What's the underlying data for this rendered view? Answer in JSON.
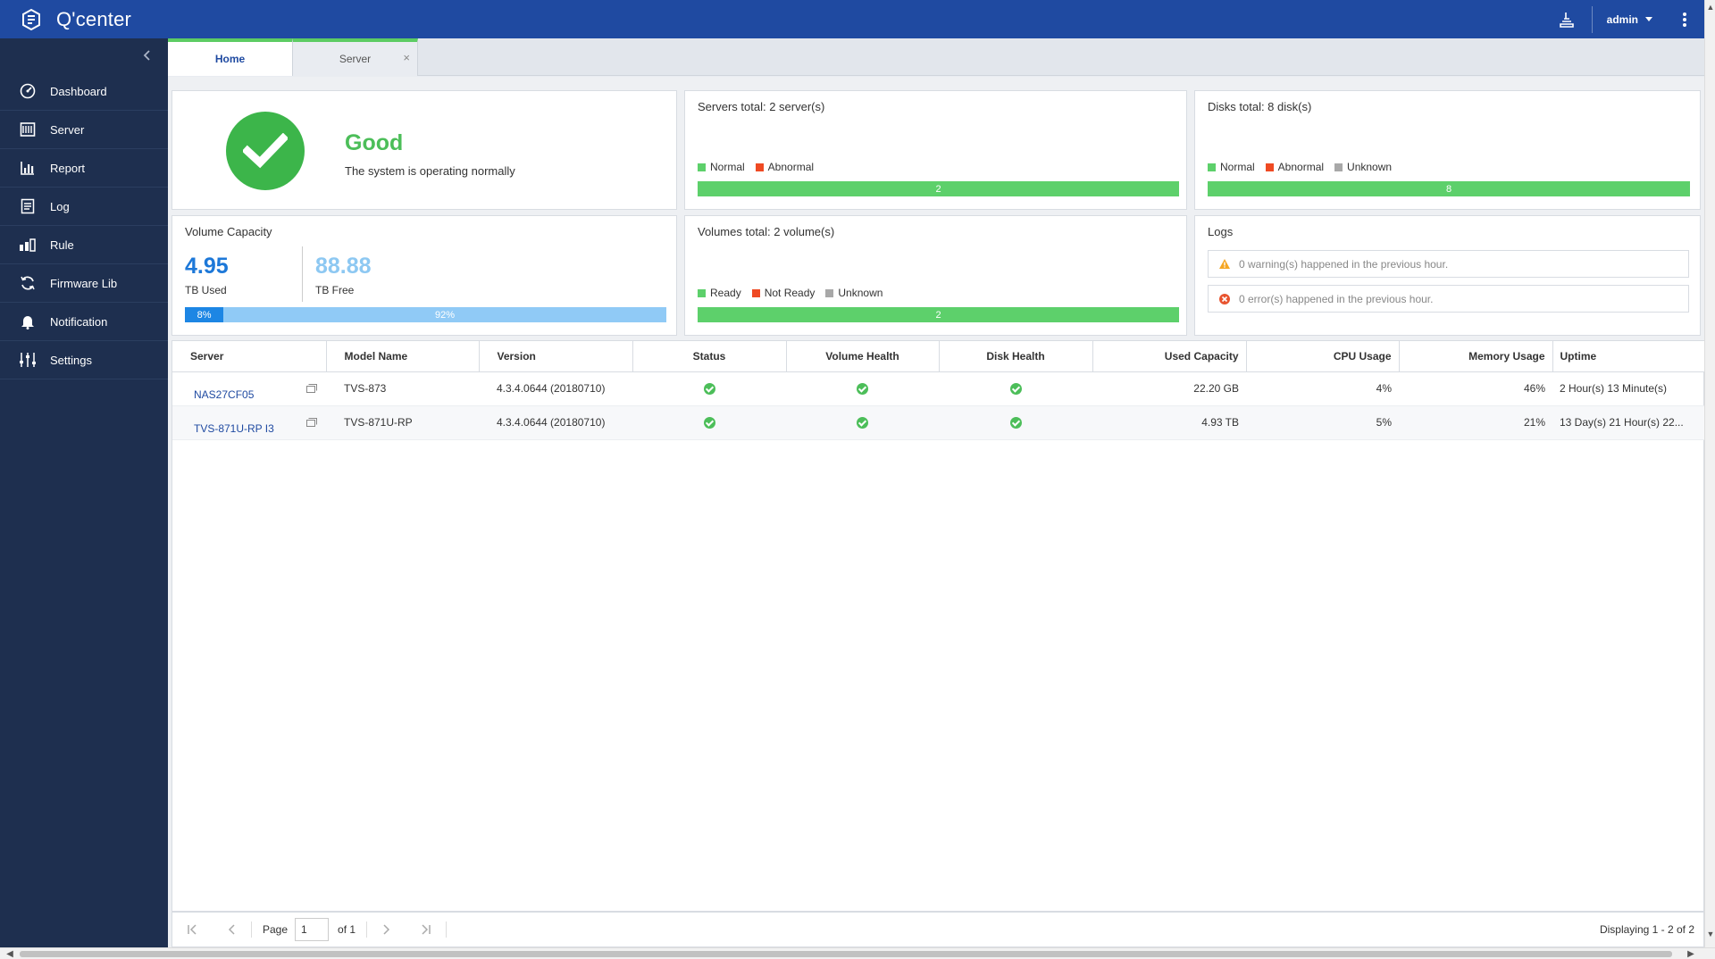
{
  "app": {
    "title": "Q'center",
    "user": "admin"
  },
  "tabs": [
    {
      "label": "Home",
      "active": true
    },
    {
      "label": "Server",
      "active": false,
      "close": "×"
    }
  ],
  "sidebar": {
    "items": [
      {
        "label": "Dashboard",
        "icon": "dashboard-icon"
      },
      {
        "label": "Server",
        "icon": "server-icon"
      },
      {
        "label": "Report",
        "icon": "report-icon"
      },
      {
        "label": "Log",
        "icon": "log-icon"
      },
      {
        "label": "Rule",
        "icon": "rule-icon"
      },
      {
        "label": "Firmware Lib",
        "icon": "firmware-icon"
      },
      {
        "label": "Notification",
        "icon": "bell-icon"
      },
      {
        "label": "Settings",
        "icon": "settings-icon"
      }
    ]
  },
  "status": {
    "title": "Good",
    "subtitle": "The system is operating normally"
  },
  "servers_card": {
    "title": "Servers total: 2 server(s)",
    "legend": [
      "Normal",
      "Abnormal"
    ],
    "bar_value": "2"
  },
  "disks_card": {
    "title": "Disks total: 8 disk(s)",
    "legend": [
      "Normal",
      "Abnormal",
      "Unknown"
    ],
    "bar_value": "8"
  },
  "volume_capacity": {
    "title": "Volume Capacity",
    "used_value": "4.95",
    "used_label": "TB Used",
    "free_value": "88.88",
    "free_label": "TB Free",
    "used_pct": "8%",
    "free_pct": "92%"
  },
  "volumes_card": {
    "title": "Volumes total: 2 volume(s)",
    "legend": [
      "Ready",
      "Not Ready",
      "Unknown"
    ],
    "bar_value": "2"
  },
  "logs_card": {
    "title": "Logs",
    "warning_text": "0 warning(s) happened in the previous hour.",
    "error_text": "0 error(s) happened in the previous hour."
  },
  "colors": {
    "normal": "#5dd06b",
    "abnormal": "#ef4a23",
    "unknown": "#a8a8a8",
    "brand": "#1f4aa1"
  },
  "table": {
    "headers": [
      "Server",
      "Model Name",
      "Version",
      "Status",
      "Volume Health",
      "Disk Health",
      "Used Capacity",
      "CPU Usage",
      "Memory Usage",
      "Uptime"
    ],
    "rows": [
      {
        "server": "NAS27CF05",
        "model": "TVS-873",
        "version": "4.3.4.0644 (20180710)",
        "used": "22.20 GB",
        "cpu": "4%",
        "mem": "46%",
        "uptime": "2 Hour(s) 13 Minute(s)"
      },
      {
        "server": "TVS-871U-RP I3",
        "model": "TVS-871U-RP",
        "version": "4.3.4.0644 (20180710)",
        "used": "4.93 TB",
        "cpu": "5%",
        "mem": "21%",
        "uptime": "13 Day(s) 21 Hour(s) 22..."
      }
    ]
  },
  "pager": {
    "page_label": "Page",
    "page_value": "1",
    "of_label": "of 1",
    "display_text": "Displaying 1 - 2 of 2"
  }
}
